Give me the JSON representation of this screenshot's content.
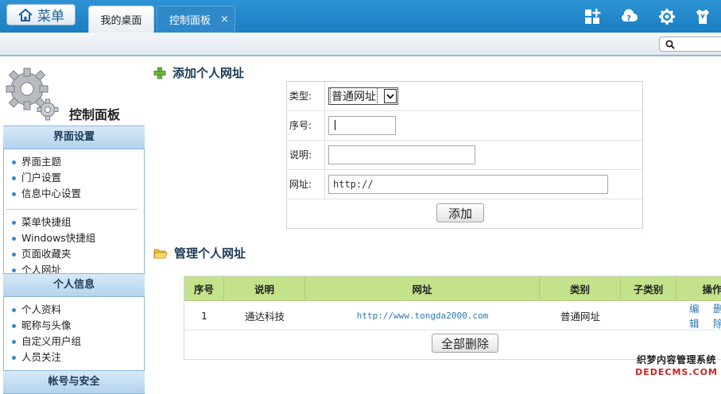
{
  "header": {
    "menu_label": "菜单",
    "tabs": [
      {
        "label": "我的桌面"
      },
      {
        "label": "控制面板",
        "close": "×"
      }
    ],
    "icons": [
      "add-widget-icon",
      "cloud-help-icon",
      "gear-icon",
      "tshirt-theme-icon"
    ],
    "accent_color": "#1b7ec2"
  },
  "search": {
    "placeholder": "",
    "value": ""
  },
  "sidebar": {
    "title": "控制面板",
    "sections": [
      {
        "heading": "界面设置",
        "groups": [
          [
            "界面主题",
            "门户设置",
            "信息中心设置"
          ],
          [
            "菜单快捷组",
            "Windows快捷组",
            "页面收藏夹",
            "个人网址"
          ]
        ]
      },
      {
        "heading": "个人信息",
        "groups": [
          [
            "个人资料",
            "昵称与头像",
            "自定义用户组",
            "人员关注"
          ]
        ]
      },
      {
        "heading": "帐号与安全",
        "groups": []
      }
    ]
  },
  "add_section": {
    "title": "添加个人网址",
    "type_label": "类型:",
    "type_value": "普通网址",
    "seq_label": "序号:",
    "seq_value": "",
    "desc_label": "说明:",
    "desc_value": "",
    "url_label": "网址:",
    "url_value": "http://",
    "submit_label": "添加"
  },
  "manage_section": {
    "title": "管理个人网址",
    "columns": [
      "序号",
      "说明",
      "网址",
      "类别",
      "子类别",
      "操作"
    ],
    "rows": [
      {
        "seq": "1",
        "desc": "通达科技",
        "url": "http://www.tongda2000.com",
        "type": "普通网址",
        "subtype": "",
        "edit": "编辑",
        "delete": "删除"
      }
    ],
    "delete_all_label": "全部删除"
  },
  "watermark": {
    "line1": "织梦内容管理系统",
    "line2": "DEDECMS.COM"
  }
}
